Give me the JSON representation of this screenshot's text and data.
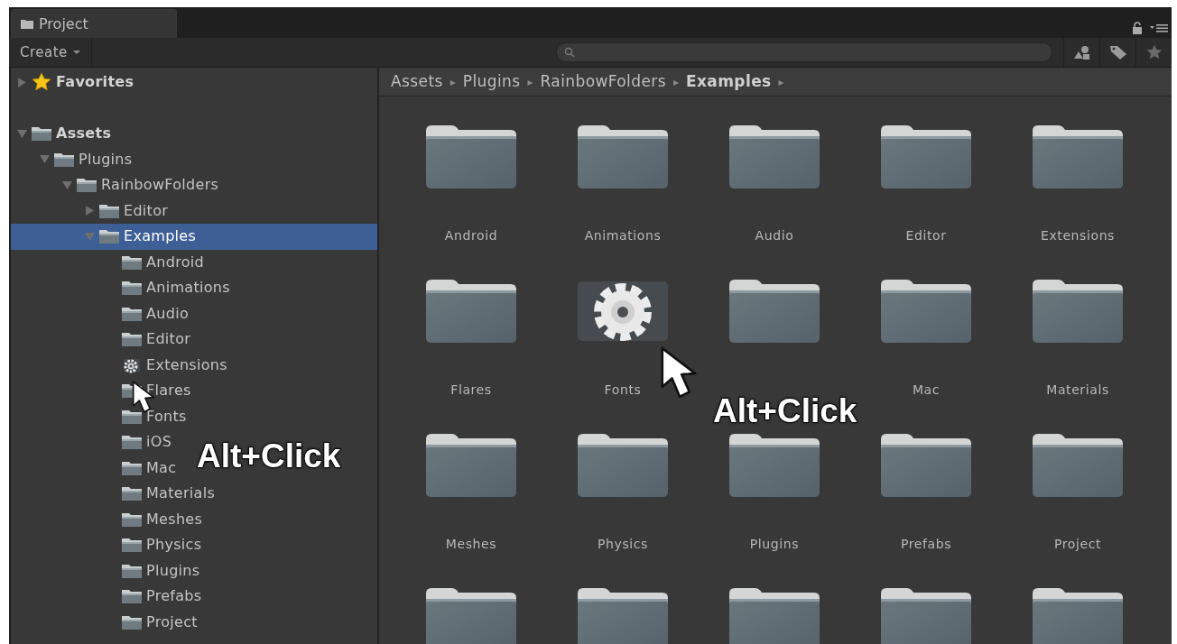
{
  "window": {
    "tab": {
      "label": "Project",
      "selected": true
    }
  },
  "toolbar": {
    "create": "Create"
  },
  "tree": [
    {
      "label": "Favorites",
      "kind": "star",
      "expanded": false
    },
    {
      "label": "Assets",
      "kind": "folder",
      "expanded": true,
      "children": [
        {
          "label": "Plugins",
          "kind": "folder",
          "expanded": true,
          "children": [
            {
              "label": "RainbowFolders",
              "kind": "folder",
              "expanded": true,
              "children": [
                {
                  "label": "Editor",
                  "kind": "folder",
                  "expanded": false
                },
                {
                  "label": "Examples",
                  "kind": "folder",
                  "expanded": true,
                  "selected": true,
                  "children": [
                    {
                      "label": "Android",
                      "kind": "folder"
                    },
                    {
                      "label": "Animations",
                      "kind": "folder"
                    },
                    {
                      "label": "Audio",
                      "kind": "folder"
                    },
                    {
                      "label": "Editor",
                      "kind": "folder"
                    },
                    {
                      "label": "Extensions",
                      "kind": "gear"
                    },
                    {
                      "label": "Flares",
                      "kind": "folder"
                    },
                    {
                      "label": "Fonts",
                      "kind": "folder"
                    },
                    {
                      "label": "iOS",
                      "kind": "folder"
                    },
                    {
                      "label": "Mac",
                      "kind": "folder"
                    },
                    {
                      "label": "Materials",
                      "kind": "folder"
                    },
                    {
                      "label": "Meshes",
                      "kind": "folder"
                    },
                    {
                      "label": "Physics",
                      "kind": "folder"
                    },
                    {
                      "label": "Plugins",
                      "kind": "folder"
                    },
                    {
                      "label": "Prefabs",
                      "kind": "folder"
                    },
                    {
                      "label": "Project",
                      "kind": "folder"
                    }
                  ]
                }
              ]
            }
          ]
        }
      ]
    }
  ],
  "breadcrumb": [
    {
      "label": "Assets",
      "separator": "▸",
      "current": false
    },
    {
      "label": "Plugins",
      "separator": "▸",
      "current": false
    },
    {
      "label": "RainbowFolders",
      "separator": "▸",
      "current": false
    },
    {
      "label": "Examples",
      "separator": "▸",
      "current": true
    }
  ],
  "grid": [
    {
      "label": "Android",
      "kind": "folder"
    },
    {
      "label": "Animations",
      "kind": "folder"
    },
    {
      "label": "Audio",
      "kind": "folder"
    },
    {
      "label": "Editor",
      "kind": "folder"
    },
    {
      "label": "Extensions",
      "kind": "folder"
    },
    {
      "label": "Flares",
      "kind": "folder"
    },
    {
      "label": "Fonts",
      "kind": "gear"
    },
    {
      "kind": "folder"
    },
    {
      "label": "Mac",
      "kind": "folder"
    },
    {
      "label": "Materials",
      "kind": "folder"
    },
    {
      "label": "Meshes",
      "kind": "folder"
    },
    {
      "label": "Physics",
      "kind": "folder"
    },
    {
      "label": "Plugins",
      "kind": "folder"
    },
    {
      "label": "Prefabs",
      "kind": "folder"
    },
    {
      "label": "Project",
      "kind": "folder"
    },
    {
      "kind": "folder"
    },
    {
      "kind": "folder"
    },
    {
      "kind": "folder"
    },
    {
      "kind": "folder"
    },
    {
      "kind": "folder"
    }
  ],
  "annotations": [
    {
      "label": "Alt+Click"
    },
    {
      "label": "Alt+Click"
    }
  ]
}
